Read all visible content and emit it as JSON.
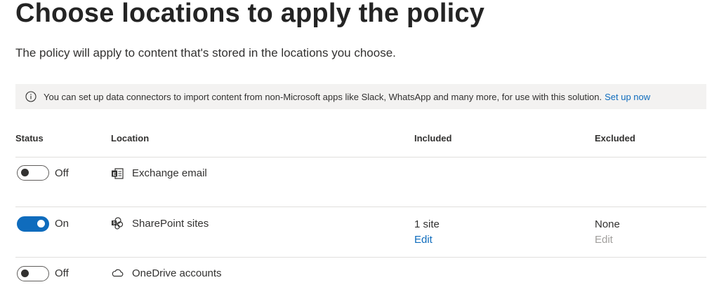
{
  "page": {
    "title": "Choose locations to apply the policy",
    "subtitle": "The policy will apply to content that's stored in the locations you choose."
  },
  "info_bar": {
    "icon": "info-icon",
    "message": "You can set up data connectors to import content from non-Microsoft apps like Slack, WhatsApp and many more, for use with this solution.",
    "link": "Set up now"
  },
  "table": {
    "headers": {
      "status": "Status",
      "location": "Location",
      "included": "Included",
      "excluded": "Excluded"
    },
    "rows": [
      {
        "status": "Off",
        "enabled": false,
        "icon": "exchange-icon",
        "location": "Exchange email",
        "included": "",
        "included_action": "",
        "excluded": "",
        "excluded_action": ""
      },
      {
        "status": "On",
        "enabled": true,
        "icon": "sharepoint-icon",
        "location": "SharePoint sites",
        "included": "1 site",
        "included_action": "Edit",
        "excluded": "None",
        "excluded_action": "Edit"
      },
      {
        "status": "Off",
        "enabled": false,
        "icon": "onedrive-icon",
        "location": "OneDrive accounts",
        "included": "",
        "included_action": "",
        "excluded": "",
        "excluded_action": ""
      }
    ]
  },
  "colors": {
    "accent": "#0f6cbd",
    "info_bar_bg": "#f3f2f1",
    "disabled_text": "#a19f9d"
  }
}
